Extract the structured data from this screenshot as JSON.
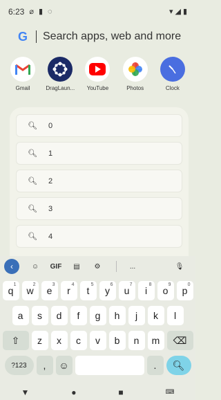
{
  "status_bar": {
    "time": "6:23"
  },
  "search": {
    "placeholder": "Search apps, web and more"
  },
  "apps": [
    {
      "label": "Gmail",
      "icon": "gmail-icon"
    },
    {
      "label": "DragLaun...",
      "icon": "draglauncher-icon"
    },
    {
      "label": "YouTube",
      "icon": "youtube-icon"
    },
    {
      "label": "Photos",
      "icon": "photos-icon"
    },
    {
      "label": "Clock",
      "icon": "clock-icon"
    }
  ],
  "suggestions": [
    "0",
    "1",
    "2",
    "3",
    "4"
  ],
  "keyboard": {
    "toolbar": {
      "gif_label": "GIF",
      "more_label": "..."
    },
    "row1": [
      "q",
      "w",
      "e",
      "r",
      "t",
      "y",
      "u",
      "i",
      "o",
      "p"
    ],
    "row1_sup": [
      "1",
      "2",
      "3",
      "4",
      "5",
      "6",
      "7",
      "8",
      "9",
      "0"
    ],
    "row2": [
      "a",
      "s",
      "d",
      "f",
      "g",
      "h",
      "j",
      "k",
      "l"
    ],
    "row3": [
      "z",
      "x",
      "c",
      "v",
      "b",
      "n",
      "m"
    ],
    "symbols_label": "?123",
    "comma": ",",
    "period": "."
  }
}
